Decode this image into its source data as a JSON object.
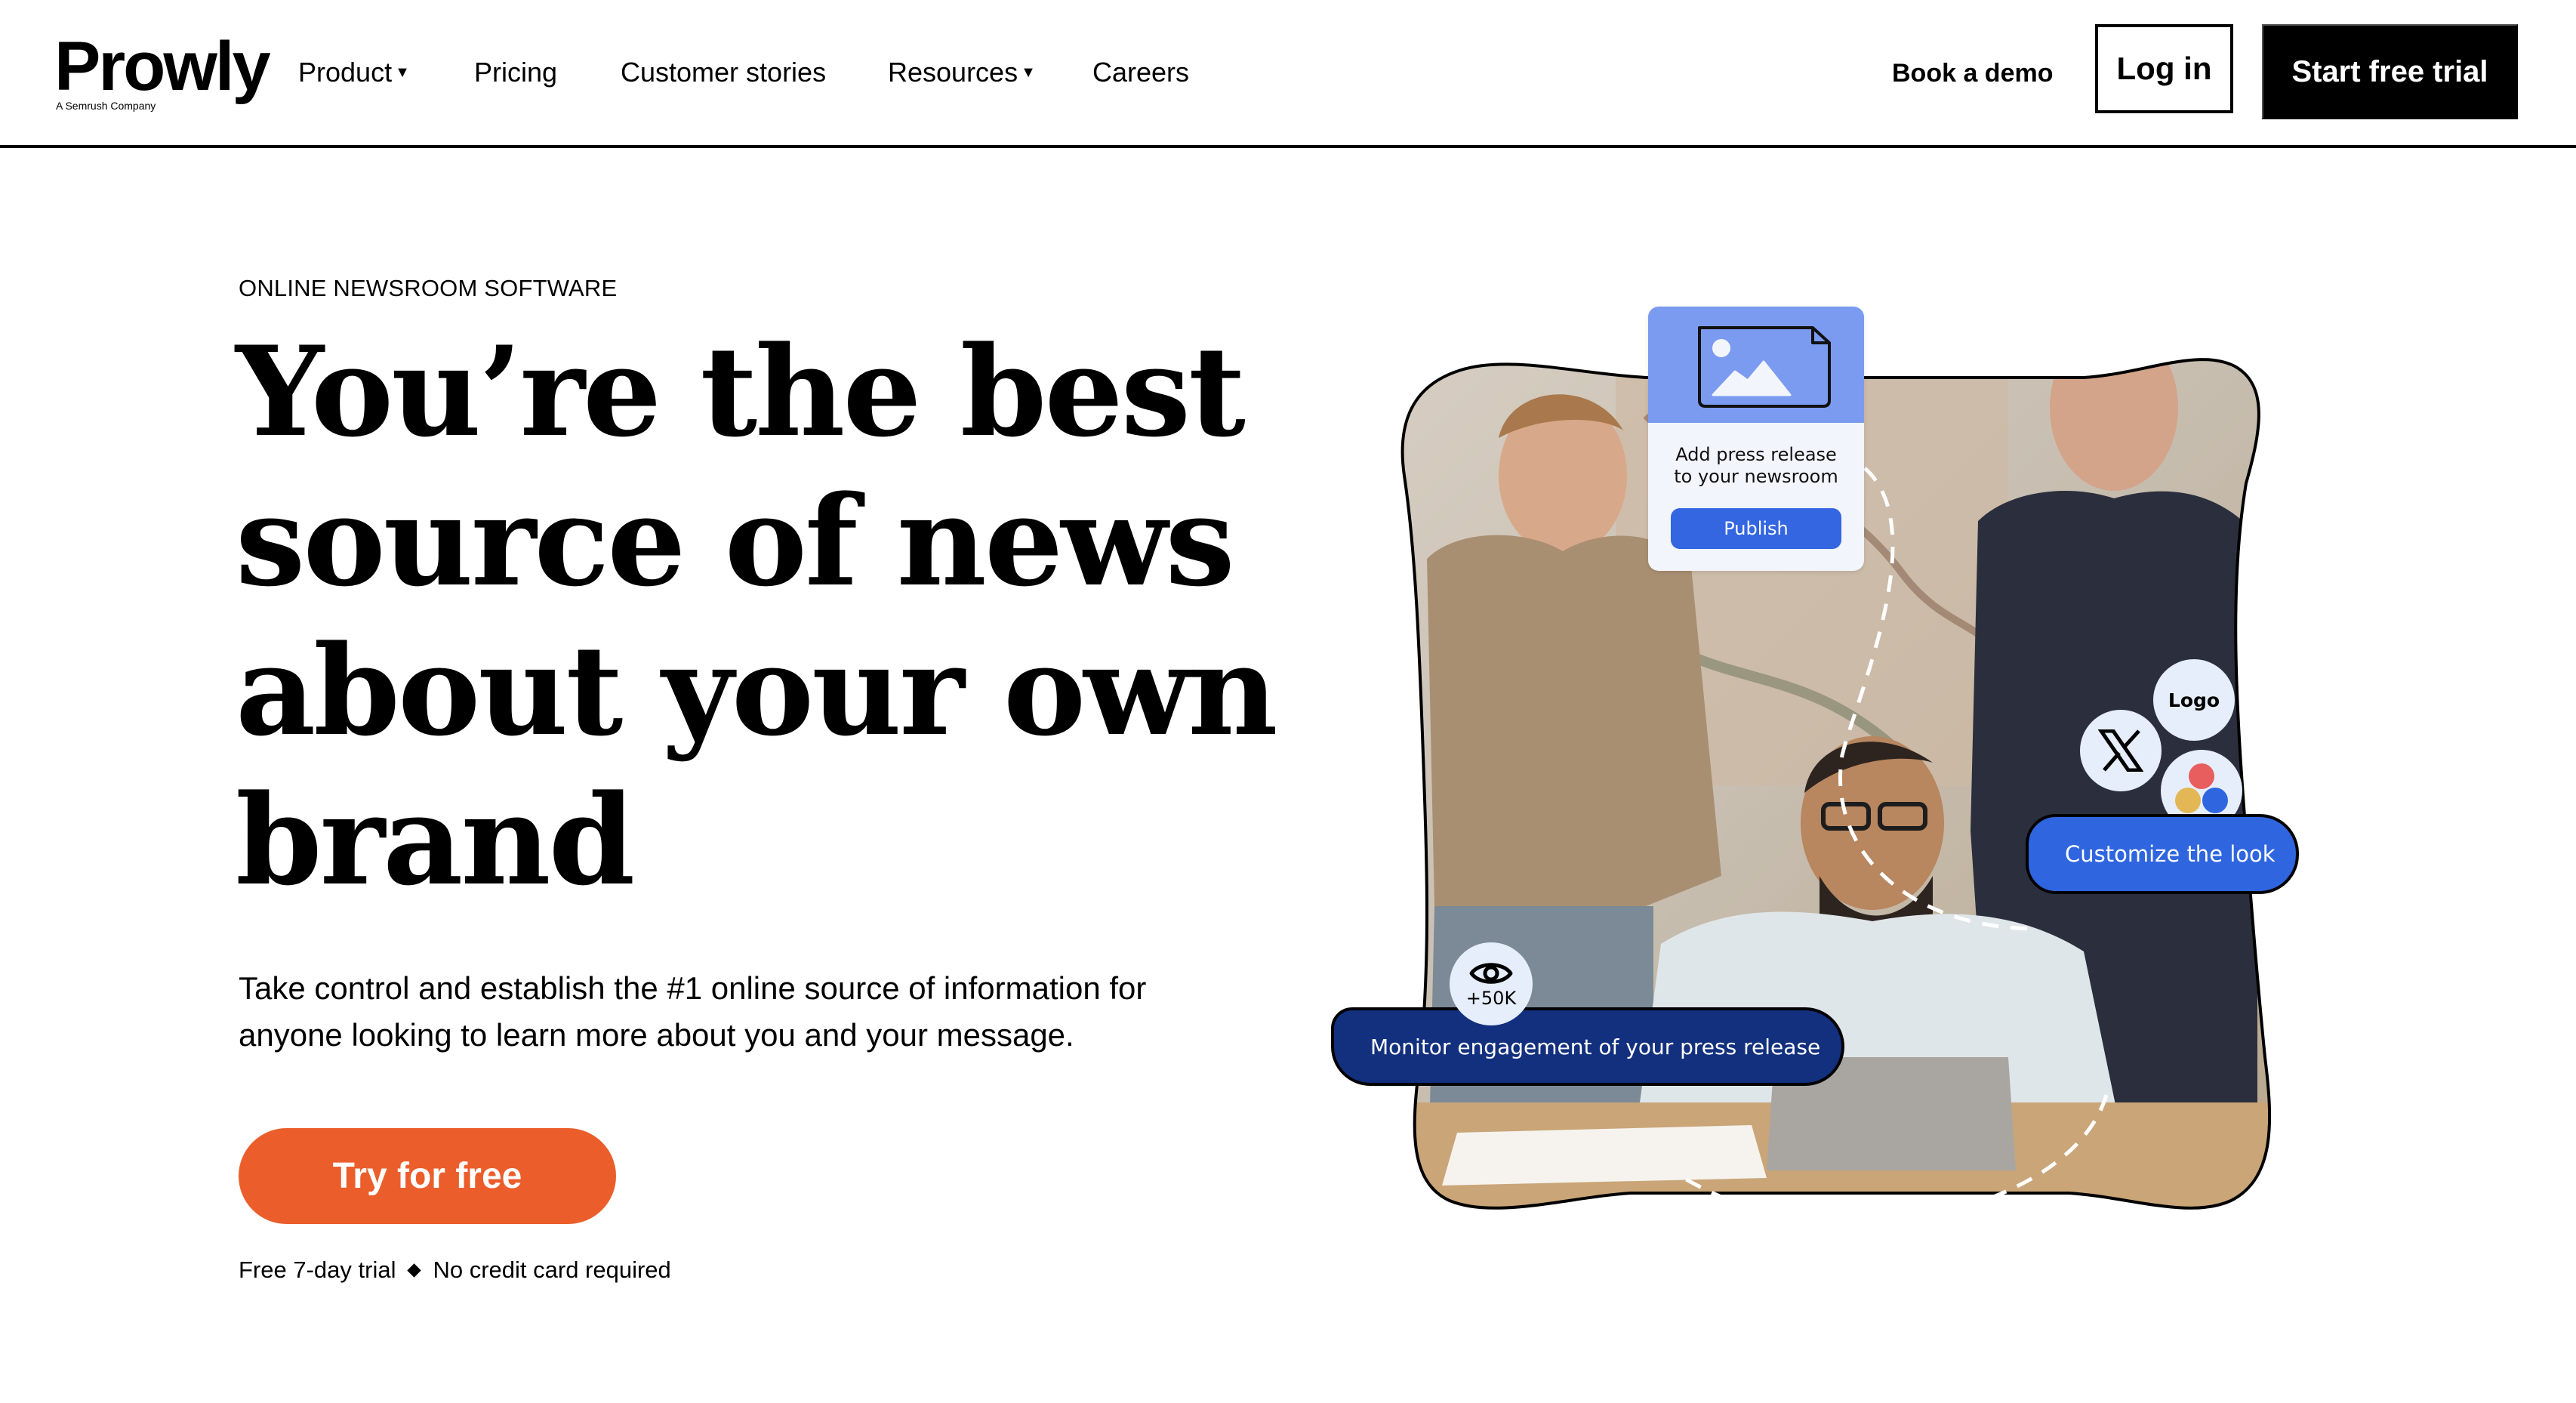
{
  "header": {
    "logo": "Prowly",
    "logo_tagline": "A Semrush Company",
    "nav": [
      {
        "label": "Product",
        "has_dropdown": true
      },
      {
        "label": "Pricing",
        "has_dropdown": false
      },
      {
        "label": "Customer stories",
        "has_dropdown": false
      },
      {
        "label": "Resources",
        "has_dropdown": true
      },
      {
        "label": "Careers",
        "has_dropdown": false
      }
    ],
    "book_demo": "Book a demo",
    "login": "Log in",
    "start_trial": "Start free trial"
  },
  "hero": {
    "eyebrow": "ONLINE NEWSROOM SOFTWARE",
    "headline_lines": [
      "You’re the best",
      "source of news",
      "about your own",
      "brand"
    ],
    "subtext": "Take control and establish the #1 online source of information for anyone looking to learn more about you and your message.",
    "cta": "Try for free",
    "fineprint": {
      "left": "Free 7-day trial",
      "right": "No credit card required"
    }
  },
  "illustration": {
    "card": {
      "icon": "image-document-icon",
      "text_line1": "Add press release",
      "text_line2": "to your newsroom",
      "button": "Publish"
    },
    "customize": {
      "logo_bubble": "Logo",
      "x_icon": "x-logo-icon",
      "colors_icon": "color-palette-icon",
      "label": "Customize the look"
    },
    "monitor": {
      "icon": "eye-icon",
      "count": "+50K",
      "label": "Monitor engagement of your press release"
    }
  },
  "colors": {
    "cta_orange": "#EB5E2B",
    "publish_blue": "#3366E0",
    "card_header_blue": "#7B9BF0",
    "customize_blue": "#2F66E0",
    "monitor_navy": "#13307E",
    "dot_red": "#E85D5D",
    "dot_yellow": "#E3B755",
    "dot_blue": "#2F66E0"
  }
}
